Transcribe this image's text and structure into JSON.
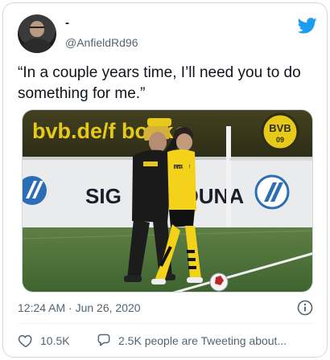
{
  "author": {
    "display_name": "-",
    "handle": "@AnfieldRd96",
    "avatar_icon": "profile-avatar",
    "platform_icon": "twitter-bird-icon"
  },
  "tweet": {
    "text": "“In a couple years time, I’ll need you to do something for me.”"
  },
  "photo": {
    "banner_text": "bvb.de/f      book",
    "badge_text": "BVB",
    "badge_sub": "09",
    "sponsor_left": "SIG",
    "sponsor_right": "DUNA",
    "jersey_text": "EVONIK"
  },
  "meta": {
    "timestamp": "12:24 AM · Jun 26, 2020",
    "info_icon": "info-icon"
  },
  "actions": {
    "likes": "10.5K",
    "conversation": "2.5K people are Tweeting about..."
  },
  "colors": {
    "twitter_blue": "#1d9bf0",
    "secondary_text": "#536471",
    "bvb_yellow": "#f7d417"
  }
}
